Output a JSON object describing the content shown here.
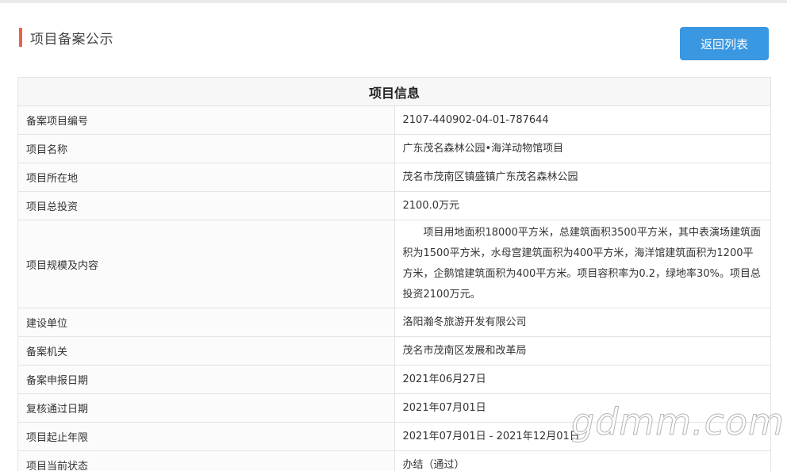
{
  "header": {
    "title": "项目备案公示",
    "accent_color": "#e9624b"
  },
  "back_button": {
    "label": "返回列表",
    "color": "#3a97e1"
  },
  "table": {
    "title": "项目信息",
    "rows": [
      {
        "label": "备案项目编号",
        "value": "2107-440902-04-01-787644"
      },
      {
        "label": "项目名称",
        "value": "广东茂名森林公园•海洋动物馆项目"
      },
      {
        "label": "项目所在地",
        "value": "茂名市茂南区镇盛镇广东茂名森林公园"
      },
      {
        "label": "项目总投资",
        "value": "2100.0万元"
      },
      {
        "label": "项目规模及内容",
        "value": "项目用地面积18000平方米，总建筑面积3500平方米，其中表演场建筑面积为1500平方米，水母宫建筑面积为400平方米，海洋馆建筑面积为1200平方米，企鹅馆建筑面积为400平方米。项目容积率为0.2，绿地率30%。项目总投资2100万元。"
      },
      {
        "label": "建设单位",
        "value": "洛阳瀚冬旅游开发有限公司"
      },
      {
        "label": "备案机关",
        "value": "茂名市茂南区发展和改革局"
      },
      {
        "label": "备案申报日期",
        "value": "2021年06月27日"
      },
      {
        "label": "复核通过日期",
        "value": "2021年07月01日"
      },
      {
        "label": "项目起止年限",
        "value": "2021年07月01日 - 2021年12月01日"
      },
      {
        "label": "项目当前状态",
        "value": "办结（通过）"
      }
    ]
  },
  "watermark": "gdmm.com"
}
